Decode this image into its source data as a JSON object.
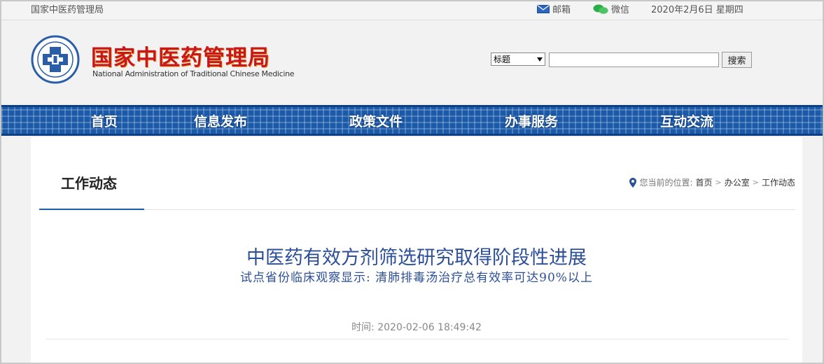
{
  "topbar": {
    "site_name": "国家中医药管理局",
    "mail_label": "邮箱",
    "wechat_label": "微信",
    "date": "2020年2月6日 星期四"
  },
  "header": {
    "logo_cn": "国家中医药管理局",
    "logo_en": "National Administration of Traditional Chinese Medicine"
  },
  "search": {
    "select_value": "标题",
    "input_value": "",
    "button_label": "搜索"
  },
  "nav": {
    "items": [
      {
        "label": "首页"
      },
      {
        "label": "信息发布"
      },
      {
        "label": "政策文件"
      },
      {
        "label": "办事服务"
      },
      {
        "label": "互动交流"
      }
    ]
  },
  "section": {
    "title": "工作动态"
  },
  "breadcrumb": {
    "prefix": "您当前的位置:",
    "items": [
      "首页",
      "办公室",
      "工作动态"
    ],
    "separator": ">"
  },
  "article": {
    "title": "中医药有效方剂筛选研究取得阶段性进展",
    "subtitle": "试点省份临床观察显示: 清肺排毒汤治疗总有效率可达90%以上",
    "time_label": "时间:",
    "time_value": "2020-02-06 18:49:42"
  },
  "colors": {
    "brand_blue": "#1b5aa8",
    "logo_red": "#c8161d",
    "title_blue": "#2c4f9a"
  },
  "icons": {
    "mail": "mail-icon",
    "wechat": "wechat-icon",
    "location": "location-pin-icon",
    "select_arrow": "dropdown-arrow-icon"
  }
}
